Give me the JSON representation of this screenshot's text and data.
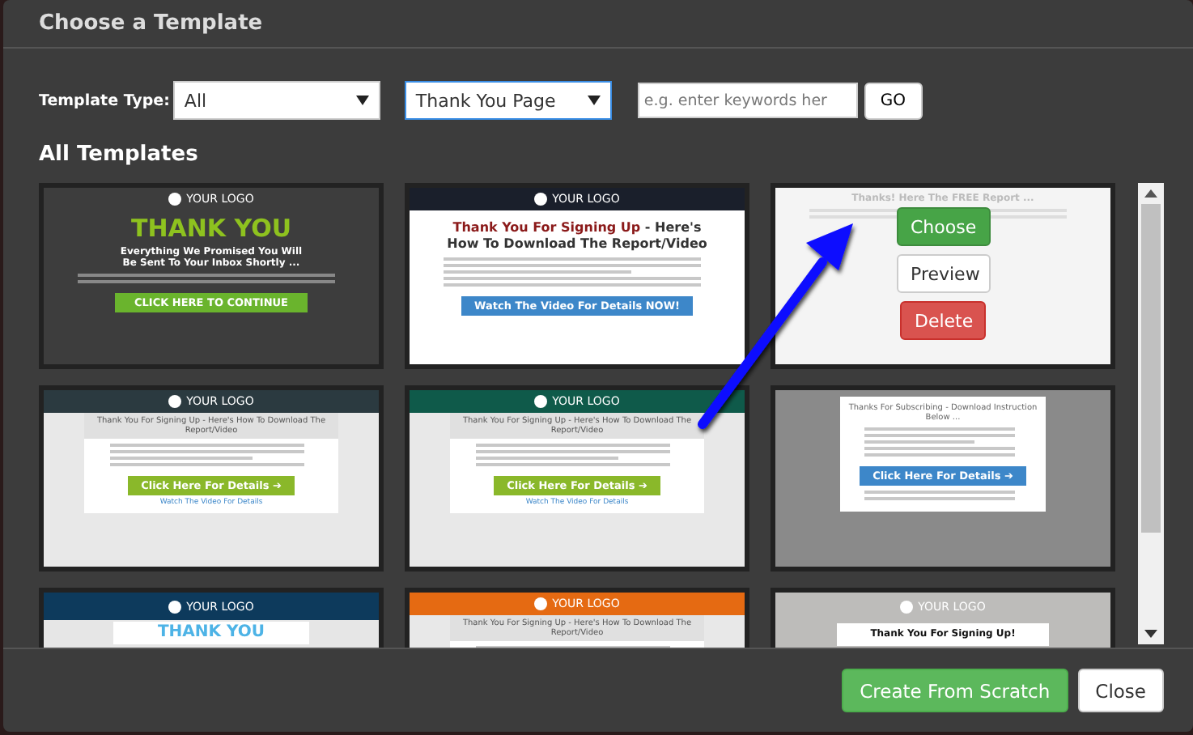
{
  "window": {
    "title": "Choose a Template"
  },
  "filters": {
    "label": "Template Type:",
    "selects": [
      {
        "value": "All",
        "focused": false
      },
      {
        "value": "Thank You Page",
        "focused": true
      }
    ],
    "search": {
      "placeholder": "e.g. enter keywords her"
    },
    "go": "GO"
  },
  "section_title": "All Templates",
  "templates": [
    {
      "kind": "dark",
      "logo": "YOUR LOGO",
      "headline": "THANK YOU",
      "subheading": "Everything We Promised You Will Be Sent To Your Inbox Shortly ...",
      "button": "CLICK HERE TO CONTINUE"
    },
    {
      "kind": "banner",
      "color": "#1a1f2b",
      "logo": "YOUR LOGO",
      "headline_accent": "Thank You For Signing Up",
      "headline": "- Here's How To Download The Report/Video",
      "button": "Watch The Video For Details NOW!"
    },
    {
      "kind": "faded",
      "headline": "Thanks! Here The FREE Report ...",
      "actions": [
        "Choose",
        "Preview",
        "Delete"
      ]
    },
    {
      "kind": "boxed",
      "color": "#2b3a40",
      "logo": "YOUR LOGO",
      "headline": "Thank You For Signing Up - Here's How To Download The Report/Video",
      "button": "Click Here For Details ➔",
      "link": "Watch The Video For Details"
    },
    {
      "kind": "boxed",
      "color": "#0f5a4a",
      "logo": "YOUR LOGO",
      "headline": "Thank You For Signing Up - Here's How To Download The Report/Video",
      "button": "Click Here For Details ➔",
      "link": "Watch The Video For Details"
    },
    {
      "kind": "card",
      "headline": "Thanks For Subscribing - Download Instruction Below ...",
      "button": "Click Here For Details ➔"
    },
    {
      "kind": "hero",
      "color": "#0d3a5c",
      "logo": "YOUR LOGO",
      "headline": "THANK YOU"
    },
    {
      "kind": "boxed",
      "color": "#e56a12",
      "logo": "YOUR LOGO",
      "headline": "Thank You For Signing Up - Here's How To Download The Report/Video"
    },
    {
      "kind": "plain-hero",
      "color": "#bdbcba",
      "logo": "YOUR LOGO",
      "headline": "Thank You For Signing Up!"
    }
  ],
  "footer_buttons": [
    {
      "label": "Create From Scratch",
      "kind": "primary"
    },
    {
      "label": "Close",
      "kind": "default"
    }
  ]
}
